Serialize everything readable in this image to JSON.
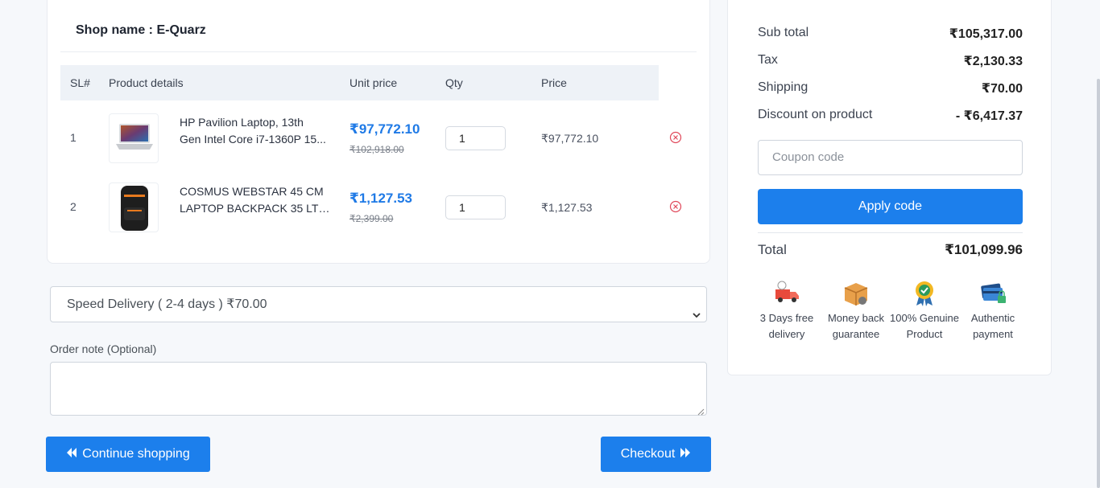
{
  "shop": {
    "label": "Shop name : E-Quarz"
  },
  "table": {
    "headers": {
      "sl": "SL#",
      "details": "Product details",
      "unit": "Unit price",
      "qty": "Qty",
      "price": "Price"
    },
    "rows": [
      {
        "sl": "1",
        "name_line1": "HP Pavilion Laptop, 13th",
        "name_line2": "Gen Intel Core i7-1360P 15...",
        "unit_price": "₹97,772.10",
        "old_price": "₹102,918.00",
        "qty": "1",
        "price": "₹97,772.10",
        "image": "laptop-image"
      },
      {
        "sl": "2",
        "name_line1": "COSMUS WEBSTAR 45 CM",
        "name_line2": "LAPTOP BACKPACK 35 LTR...",
        "unit_price": "₹1,127.53",
        "old_price": "₹2,399.00",
        "qty": "1",
        "price": "₹1,127.53",
        "image": "backpack-image"
      }
    ]
  },
  "delivery": {
    "selected": "Speed Delivery ( 2-4 days ) ₹70.00"
  },
  "order_note": {
    "label": "Order note (Optional)",
    "value": ""
  },
  "buttons": {
    "continue": "Continue shopping",
    "checkout": "Checkout"
  },
  "summary": {
    "subtotal_label": "Sub total",
    "subtotal": "₹105,317.00",
    "tax_label": "Tax",
    "tax": "₹2,130.33",
    "shipping_label": "Shipping",
    "shipping": "₹70.00",
    "discount_label": "Discount on product",
    "discount": "- ₹6,417.37",
    "coupon_placeholder": "Coupon code",
    "apply_label": "Apply code",
    "total_label": "Total",
    "total": "₹101,099.96"
  },
  "features": [
    {
      "icon": "delivery-truck-icon",
      "label": "3 Days free delivery"
    },
    {
      "icon": "money-back-box-icon",
      "label": "Money back guarantee"
    },
    {
      "icon": "genuine-badge-icon",
      "label": "100% Genuine Product"
    },
    {
      "icon": "secure-card-icon",
      "label": "Authentic payment"
    }
  ],
  "colors": {
    "primary": "#1c7fec",
    "background": "#f6f8fb",
    "remove": "#e0485a"
  }
}
